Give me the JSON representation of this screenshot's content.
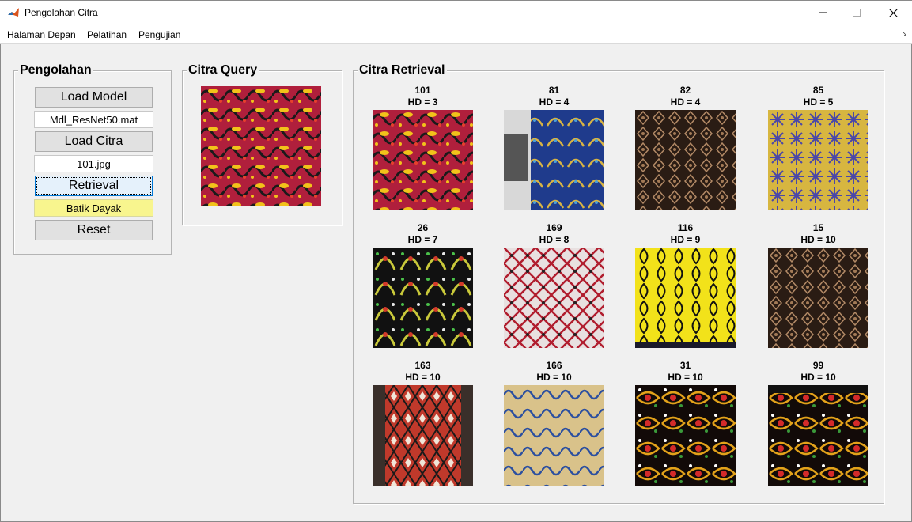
{
  "window": {
    "title": "Pengolahan Citra",
    "minimize_icon": "minimize-icon",
    "maximize_icon": "maximize-icon",
    "close_icon": "close-icon"
  },
  "menu": [
    "Halaman Depan",
    "Pelatihan",
    "Pengujian"
  ],
  "pengolahan": {
    "title": "Pengolahan",
    "load_model_label": "Load Model",
    "model_file": "Mdl_ResNet50.mat",
    "load_citra_label": "Load Citra",
    "image_file": "101.jpg",
    "retrieval_label": "Retrieval",
    "result_class": "Batik Dayak",
    "reset_label": "Reset"
  },
  "query": {
    "title": "Citra Query"
  },
  "retrieval": {
    "title": "Citra Retrieval",
    "results": [
      {
        "id": "101",
        "hd": "HD = 3"
      },
      {
        "id": "81",
        "hd": "HD = 4"
      },
      {
        "id": "82",
        "hd": "HD = 4"
      },
      {
        "id": "85",
        "hd": "HD = 5"
      },
      {
        "id": "26",
        "hd": "HD = 7"
      },
      {
        "id": "169",
        "hd": "HD = 8"
      },
      {
        "id": "116",
        "hd": "HD = 9"
      },
      {
        "id": "15",
        "hd": "HD = 10"
      },
      {
        "id": "163",
        "hd": "HD = 10"
      },
      {
        "id": "166",
        "hd": "HD = 10"
      },
      {
        "id": "31",
        "hd": "HD = 10"
      },
      {
        "id": "99",
        "hd": "HD = 10"
      }
    ]
  },
  "colors": {
    "accent": "#0078d7",
    "result_bg": "#f8f58e",
    "window_bg": "#f0f0f0"
  }
}
